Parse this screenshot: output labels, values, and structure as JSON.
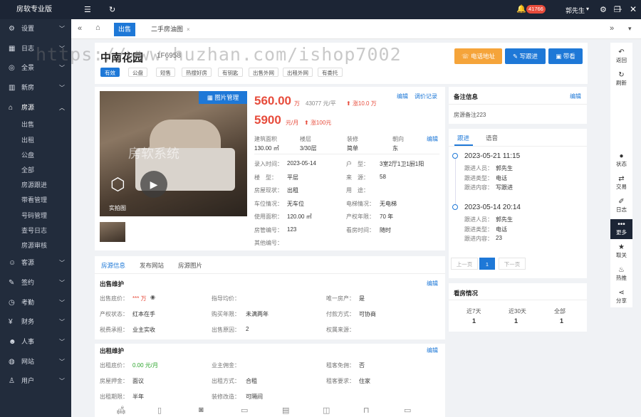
{
  "app": {
    "brand": "房软专业版",
    "menu_icon": "menu-icon",
    "refresh_icon": "refresh-icon"
  },
  "topbar": {
    "notif_badge": "41766",
    "user": "郭先生",
    "icons": [
      "bell-icon",
      "settings-icon",
      "minimize-icon",
      "maximize-icon",
      "close-icon"
    ]
  },
  "sidebar": {
    "groups_before": [
      {
        "label": "设置",
        "icon": "gear-icon"
      },
      {
        "label": "日志",
        "icon": "calendar-icon"
      },
      {
        "label": "全景",
        "icon": "panorama-icon"
      },
      {
        "label": "新房",
        "icon": "building-icon"
      }
    ],
    "open_group": {
      "label": "房源",
      "icon": "home-icon"
    },
    "sub_items": [
      "出售",
      "出租",
      "公盘",
      "全部",
      "房源跟进",
      "带看管理",
      "号码管理",
      "查号日志",
      "房源审核"
    ],
    "groups_after": [
      {
        "label": "客源",
        "icon": "user-group-icon"
      },
      {
        "label": "签约",
        "icon": "contract-icon"
      },
      {
        "label": "考勤",
        "icon": "clock-icon"
      },
      {
        "label": "财务",
        "icon": "finance-icon"
      },
      {
        "label": "人事",
        "icon": "people-icon"
      },
      {
        "label": "网站",
        "icon": "globe-icon"
      },
      {
        "label": "用户",
        "icon": "user-icon"
      }
    ]
  },
  "tabs": {
    "items": [
      {
        "label": "出售"
      },
      {
        "label": "二手房油图"
      }
    ]
  },
  "header": {
    "title": "中南花园",
    "code": "1F6958",
    "tags": [
      "有效",
      "公盘",
      "短售",
      "热搜好房",
      "有钥匙",
      "出售外网",
      "出租外网",
      "有委托"
    ],
    "buttons": {
      "phone": "电话地址",
      "follow": "写跟进",
      "viewing": "带看"
    }
  },
  "info": {
    "pic_button": "图片管理",
    "photo_label": "实拍图",
    "photo_watermark": "房软系统",
    "price": "560.00",
    "price_unit": "万",
    "unit_price": "43077 元/平",
    "price_change": "涨10.0 万",
    "rent": "5900",
    "rent_unit": "元/月",
    "rent_change": "涨100元",
    "edit": "编辑",
    "price_log": "调价记录",
    "stats": [
      {
        "label": "建筑面积",
        "value": "130.00 ㎡"
      },
      {
        "label": "楼层",
        "value": "3/30层"
      },
      {
        "label": "装修",
        "value": "简单"
      },
      {
        "label": "朝向",
        "value": "东"
      }
    ],
    "stats_edit": "编辑",
    "rows": [
      [
        {
          "label": "录入时间：",
          "value": "2023-05-14"
        },
        {
          "label": "户　型：",
          "value": "3室2厅1卫1厨1阳"
        }
      ],
      [
        {
          "label": "楼　型：",
          "value": "平层"
        },
        {
          "label": "来　源：",
          "value": "58"
        }
      ],
      [
        {
          "label": "房屋现状：",
          "value": "出租"
        },
        {
          "label": "用　途：",
          "value": ""
        }
      ],
      [
        {
          "label": "车位情况：",
          "value": "无车位"
        },
        {
          "label": "电梯情况：",
          "value": "无电梯"
        }
      ],
      [
        {
          "label": "使用面积：",
          "value": "120.00 ㎡"
        },
        {
          "label": "产权年限：",
          "value": "70 年"
        }
      ],
      [
        {
          "label": "房管编号：",
          "value": "123"
        },
        {
          "label": "看房时间：",
          "value": "随时"
        }
      ],
      [
        {
          "label": "其他编号：",
          "value": ""
        },
        {
          "label": "",
          "value": ""
        }
      ]
    ]
  },
  "detail": {
    "tabs": [
      "房源信息",
      "发布网站",
      "房源图片"
    ],
    "sale_title": "出售维护",
    "sale_edit": "编辑",
    "sale_rows": [
      [
        {
          "label": "出售底价：",
          "value": "*** 万"
        },
        {
          "label": "指导均价：",
          "value": ""
        },
        {
          "label": "唯一房产：",
          "value": "是"
        }
      ],
      [
        {
          "label": "产权状态：",
          "value": "红本在手"
        },
        {
          "label": "购买年限：",
          "value": "未满两年"
        },
        {
          "label": "付款方式：",
          "value": "可协商"
        }
      ],
      [
        {
          "label": "税费承担：",
          "value": "业主实收"
        },
        {
          "label": "出售原因：",
          "value": "2"
        },
        {
          "label": "权属来源：",
          "value": ""
        }
      ]
    ],
    "rent_title": "出租维护",
    "rent_edit": "编辑",
    "rent_rows": [
      [
        {
          "label": "出租底价：",
          "value": "0.00 元/月"
        },
        {
          "label": "业主佣金：",
          "value": ""
        },
        {
          "label": "租客免佣：",
          "value": "否"
        }
      ],
      [
        {
          "label": "房屋押金：",
          "value": "面议"
        },
        {
          "label": "出租方式：",
          "value": "合租"
        },
        {
          "label": "租客要求：",
          "value": "住家"
        }
      ],
      [
        {
          "label": "出租期限：",
          "value": "半年"
        },
        {
          "label": "装修改造：",
          "value": "可隔间"
        },
        {
          "label": "",
          "value": ""
        }
      ]
    ]
  },
  "remark": {
    "title": "备注信息",
    "edit": "编辑",
    "text": "房源备注223"
  },
  "follow": {
    "tabs": [
      "跟进",
      "语音"
    ],
    "entries": [
      {
        "time": "2023-05-21 11:15",
        "person_label": "跟进人员：",
        "person": "郭先生",
        "type_label": "跟进类型：",
        "type": "电话",
        "content_label": "跟进内容：",
        "content": "写跟进"
      },
      {
        "time": "2023-05-14 20:14",
        "person_label": "跟进人员：",
        "person": "郭先生",
        "type_label": "跟进类型：",
        "type": "电话",
        "content_label": "跟进内容：",
        "content": "23"
      }
    ],
    "pager": {
      "prev": "上一页",
      "page": "1",
      "next": "下一页"
    }
  },
  "viewing": {
    "title": "看房情况",
    "cols": [
      {
        "label": "近7天",
        "value": "1"
      },
      {
        "label": "近30天",
        "value": "1"
      },
      {
        "label": "全部",
        "value": "1"
      }
    ]
  },
  "right_tools": [
    {
      "label": "返回",
      "icon": "back-icon"
    },
    {
      "label": "刷新",
      "icon": "refresh-icon"
    },
    {
      "label": "状态",
      "icon": "info-icon"
    },
    {
      "label": "交易",
      "icon": "swap-icon"
    },
    {
      "label": "日志",
      "icon": "edit-icon"
    },
    {
      "label": "更多",
      "icon": "more-icon"
    },
    {
      "label": "取关",
      "icon": "star-icon"
    },
    {
      "label": "热推",
      "icon": "fire-icon"
    },
    {
      "label": "分享",
      "icon": "share-icon"
    }
  ],
  "watermark": "https://www.huzhan.com/ishop7002",
  "colors": {
    "primary": "#1e78d7",
    "price": "#e74c3c",
    "orange": "#f5a43a",
    "dark": "#1c2535"
  }
}
